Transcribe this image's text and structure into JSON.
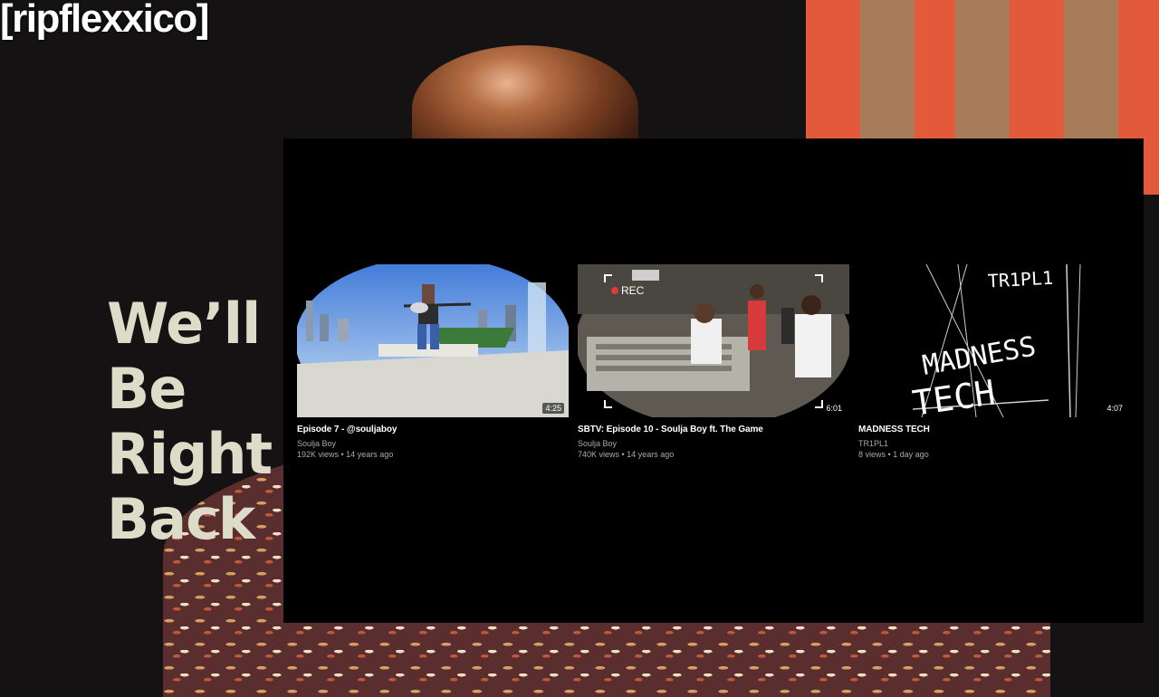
{
  "overlay_text": {
    "channel_tag": "[ripflexxico]",
    "brb_lines": [
      "We’ll",
      "Be",
      "Right",
      "Back"
    ]
  },
  "colors": {
    "end_screen_bg": "#000000",
    "stripe_orange": "#e25a3a",
    "stripe_tan": "#a67d58",
    "brb_text": "#dcdcc8"
  },
  "end_screen": {
    "videos": [
      {
        "title": "Episode 7 - @souljaboy",
        "channel": "Soulja Boy",
        "stats": "192K views • 14 years ago",
        "duration": "4:25"
      },
      {
        "title": "SBTV: Episode 10 - Soulja Boy ft. The Game",
        "channel": "Soulja Boy",
        "stats": "740K views • 14 years ago",
        "duration": "6:01",
        "overlay_rec": "REC"
      },
      {
        "title": "MADNESS TECH",
        "channel": "TR1PL1",
        "stats": "8 views • 1 day ago",
        "duration": "4:07",
        "art_text_1": "TR1PL1",
        "art_text_2": "MADNESS",
        "art_text_3": "TECH"
      }
    ]
  }
}
